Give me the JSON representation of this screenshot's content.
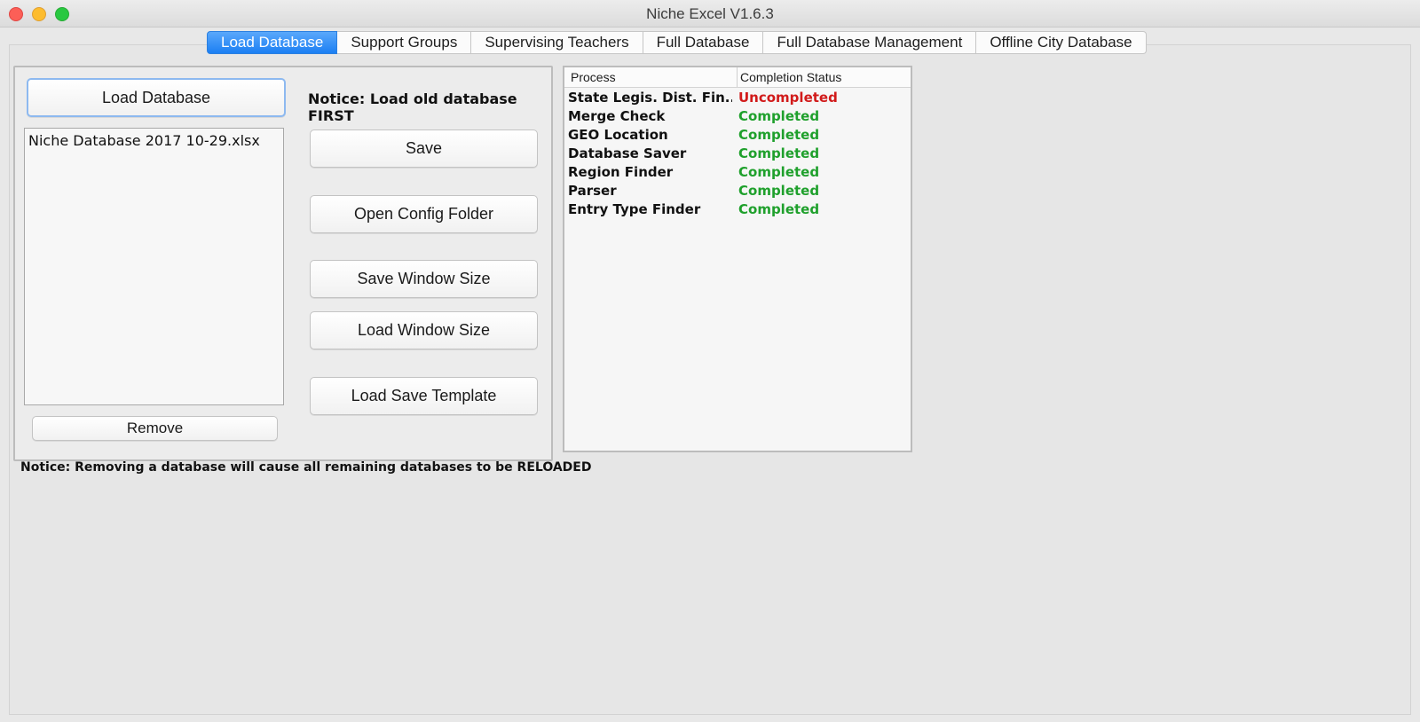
{
  "window": {
    "title": "Niche Excel V1.6.3"
  },
  "tabs": [
    {
      "label": "Load Database",
      "active": true
    },
    {
      "label": "Support Groups",
      "active": false
    },
    {
      "label": "Supervising Teachers",
      "active": false
    },
    {
      "label": "Full Database",
      "active": false
    },
    {
      "label": "Full Database Management",
      "active": false
    },
    {
      "label": "Offline City Database",
      "active": false
    }
  ],
  "left_panel": {
    "load_button": "Load Database",
    "files": [
      "Niche Database 2017 10-29.xlsx"
    ],
    "remove_button": "Remove",
    "notice_top": "Notice: Load old database FIRST",
    "buttons": {
      "save": "Save",
      "open_config": "Open Config Folder",
      "save_window_size": "Save Window Size",
      "load_window_size": "Load Window Size",
      "load_save_template": "Load Save Template"
    }
  },
  "bottom_notice": "Notice: Removing a database will cause all remaining databases to be RELOADED",
  "process_table": {
    "headers": {
      "process": "Process",
      "status": "Completion Status"
    },
    "rows": [
      {
        "process": "State Legis. Dist. Fin...",
        "status": "Uncompleted"
      },
      {
        "process": "Merge Check",
        "status": "Completed"
      },
      {
        "process": "GEO Location",
        "status": "Completed"
      },
      {
        "process": "Database Saver",
        "status": "Completed"
      },
      {
        "process": "Region Finder",
        "status": "Completed"
      },
      {
        "process": "Parser",
        "status": "Completed"
      },
      {
        "process": "Entry Type Finder",
        "status": "Completed"
      }
    ]
  },
  "colors": {
    "completed": "#1fa02c",
    "uncompleted": "#d11a1a",
    "tab_active": "#1b7ff3"
  }
}
